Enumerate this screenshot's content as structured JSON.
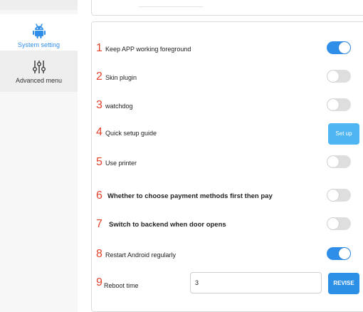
{
  "sidebar": {
    "items": [
      {
        "label": "System setting",
        "icon": "android-robot-icon",
        "active": true
      },
      {
        "label": "Advanced menu",
        "icon": "sliders-icon",
        "active": false
      }
    ]
  },
  "colors": {
    "accent": "#2f8ee8",
    "number": "#e2432b",
    "toggle_off": "#dedede",
    "setup_button": "#4fb6f2",
    "revise_button": "#2b8fe6"
  },
  "settings": [
    {
      "num": "1",
      "label": "Keep APP working foreground",
      "control": "toggle",
      "on": true
    },
    {
      "num": "2",
      "label": "Skin plugin",
      "control": "toggle",
      "on": false
    },
    {
      "num": "3",
      "label": "watchdog",
      "control": "toggle",
      "on": false
    },
    {
      "num": "4",
      "label": "Quick setup guide",
      "control": "button",
      "button_label": "Set up"
    },
    {
      "num": "5",
      "label": "Use printer",
      "control": "toggle",
      "on": false
    },
    {
      "num": "6",
      "label": "Whether to choose payment  methods first then pay",
      "control": "toggle",
      "on": false
    },
    {
      "num": "7",
      "label": "Switch to backend when door opens",
      "control": "toggle",
      "on": false
    },
    {
      "num": "8",
      "label": "Restart Android regularly",
      "control": "toggle",
      "on": true
    },
    {
      "num": "9",
      "label": "Reboot time",
      "control": "input",
      "value": "3",
      "button_label": "REVISE"
    }
  ]
}
